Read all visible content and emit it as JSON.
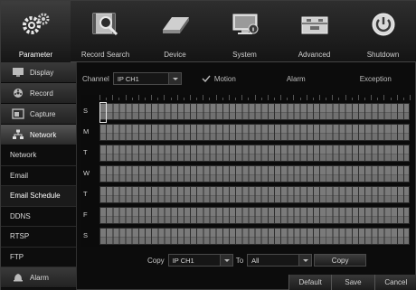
{
  "topnav": {
    "items": [
      {
        "label": "Parameter",
        "icon": "gears-icon"
      },
      {
        "label": "Record Search",
        "icon": "film-search-icon"
      },
      {
        "label": "Device",
        "icon": "hard-drive-icon"
      },
      {
        "label": "System",
        "icon": "monitor-info-icon"
      },
      {
        "label": "Advanced",
        "icon": "toolbox-icon"
      },
      {
        "label": "Shutdown",
        "icon": "power-icon"
      }
    ],
    "active": "Parameter"
  },
  "sidebar": {
    "main_items": [
      {
        "label": "Display",
        "icon": "display-icon"
      },
      {
        "label": "Record",
        "icon": "record-reel-icon"
      },
      {
        "label": "Capture",
        "icon": "capture-icon"
      },
      {
        "label": "Network",
        "icon": "network-icon"
      },
      {
        "label": "Alarm",
        "icon": "alarm-icon"
      }
    ],
    "sub_items": [
      "Network",
      "Email",
      "Email Schedule",
      "DDNS",
      "RTSP",
      "FTP"
    ],
    "selected_sub": "Email Schedule"
  },
  "header": {
    "channel_label": "Channel",
    "channel_value": "IP CH1",
    "motion_label": "Motion",
    "alarm_label": "Alarm",
    "exception_label": "Exception"
  },
  "schedule": {
    "days": [
      "S",
      "M",
      "T",
      "W",
      "T",
      "F",
      "S"
    ]
  },
  "copy_row": {
    "copy_label": "Copy",
    "from_value": "IP CH1",
    "to_label": "To",
    "to_value": "All",
    "copy_button": "Copy"
  },
  "bottom_bar": {
    "default": "Default",
    "save": "Save",
    "cancel": "Cancel"
  },
  "colors": {
    "background": "#0c0c0c",
    "grid_fill": "#7a7a7a",
    "text": "#d0d0d0"
  }
}
